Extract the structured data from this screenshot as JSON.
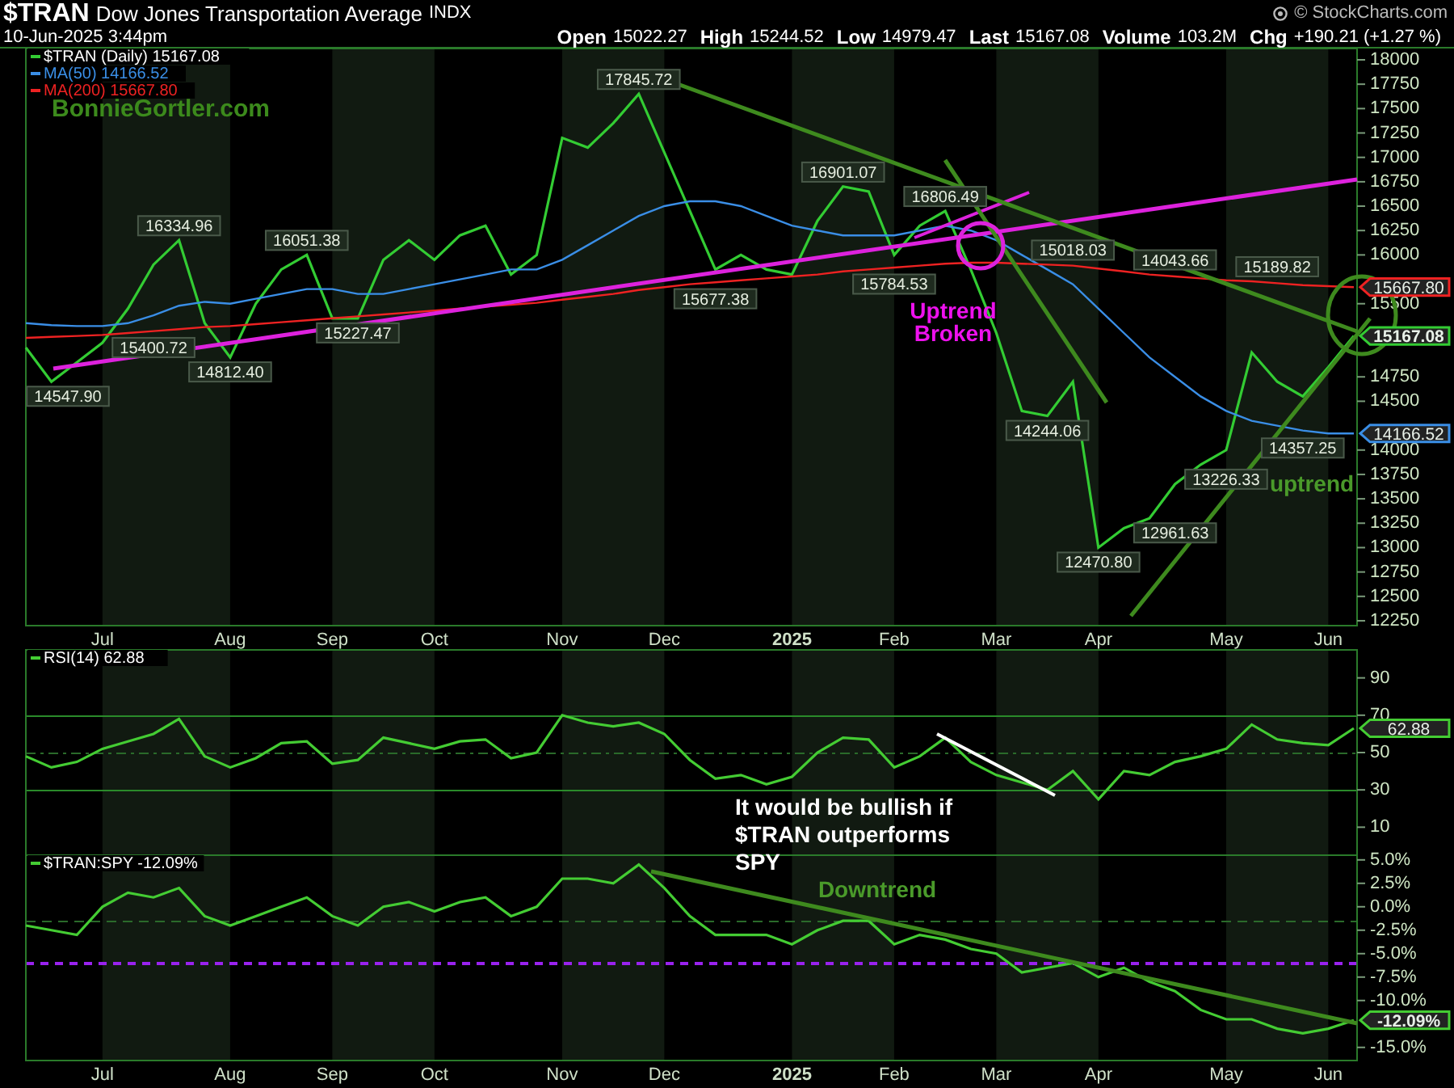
{
  "header": {
    "symbol": "$TRAN",
    "name": "Dow Jones Transportation Average",
    "exchange": "INDX",
    "credit": "© StockCharts.com",
    "date": "10-Jun-2025 3:44pm",
    "quote": [
      {
        "label": "Open",
        "value": "15022.27"
      },
      {
        "label": "High",
        "value": "15244.52"
      },
      {
        "label": "Low",
        "value": "14979.47"
      },
      {
        "label": "Last",
        "value": "15167.08"
      },
      {
        "label": "Volume",
        "value": "103.2M"
      },
      {
        "label": "Chg",
        "value": "+190.21 (+1.27 %)"
      }
    ]
  },
  "price_panel": {
    "site_text": "BonnieGortler.com",
    "price_labels": [
      {
        "kind": "low",
        "text": "14547.90"
      },
      {
        "kind": "low",
        "text": "15400.72"
      },
      {
        "kind": "low",
        "text": "14812.40"
      },
      {
        "kind": "high",
        "text": "16334.96"
      },
      {
        "kind": "high",
        "text": "16051.38"
      },
      {
        "kind": "low",
        "text": "15227.47"
      },
      {
        "kind": "high",
        "text": "17845.72"
      },
      {
        "kind": "low",
        "text": "15677.38"
      },
      {
        "kind": "high",
        "text": "16901.07"
      },
      {
        "kind": "low",
        "text": "15784.53"
      },
      {
        "kind": "high",
        "text": "16806.49"
      },
      {
        "kind": "high",
        "text": "15018.03"
      },
      {
        "kind": "low",
        "text": "14244.06"
      },
      {
        "kind": "low",
        "text": "12470.80"
      },
      {
        "kind": "low",
        "text": "12961.63"
      },
      {
        "kind": "low",
        "text": "13226.33"
      },
      {
        "kind": "high",
        "text": "14043.66"
      },
      {
        "kind": "high",
        "text": "15189.82"
      },
      {
        "kind": "low",
        "text": "14357.25"
      }
    ],
    "notes": [
      {
        "lines": [
          "Uptrend",
          "Broken"
        ]
      },
      {
        "lines": [
          "uptrend"
        ]
      }
    ],
    "value_tags": [
      "15667.80",
      "15167.08",
      "14166.52"
    ],
    "chart_data": {
      "type": "line",
      "ylim": [
        12200,
        18116
      ],
      "categories": [
        null,
        null,
        null,
        "Jul",
        null,
        null,
        null,
        null,
        "Aug",
        null,
        null,
        null,
        "Sep",
        null,
        null,
        null,
        "Oct",
        null,
        null,
        null,
        null,
        "Nov",
        null,
        null,
        null,
        "Dec",
        null,
        null,
        null,
        null,
        "2025",
        null,
        null,
        null,
        "Feb",
        null,
        null,
        null,
        "Mar",
        null,
        null,
        null,
        "Apr",
        null,
        null,
        null,
        null,
        "May",
        null,
        null,
        null,
        "Jun",
        null
      ],
      "series": [
        {
          "name": "$TRAN (Daily) 15167.08",
          "color": "#33cc33",
          "values": [
            15050,
            14700,
            14900,
            15100,
            15450,
            15900,
            16150,
            15300,
            14950,
            15500,
            15850,
            16000,
            15350,
            15350,
            15950,
            16150,
            15950,
            16200,
            16300,
            15800,
            16000,
            17200,
            17100,
            17350,
            17650,
            17050,
            16450,
            15850,
            16000,
            15850,
            15800,
            16350,
            16700,
            16650,
            16000,
            16300,
            16450,
            15850,
            15200,
            14400,
            14350,
            14700,
            13000,
            13200,
            13300,
            13650,
            13850,
            14000,
            15000,
            14700,
            14550,
            14850,
            15170
          ]
        },
        {
          "name": "MA(50) 14166.52",
          "color": "#3a8ee6",
          "values": [
            15300,
            15280,
            15270,
            15270,
            15300,
            15380,
            15480,
            15520,
            15500,
            15550,
            15600,
            15650,
            15650,
            15600,
            15600,
            15650,
            15700,
            15750,
            15800,
            15850,
            15850,
            15950,
            16100,
            16250,
            16400,
            16500,
            16550,
            16550,
            16500,
            16400,
            16300,
            16250,
            16200,
            16200,
            16200,
            16250,
            16300,
            16250,
            16150,
            16000,
            15850,
            15700,
            15450,
            15200,
            14950,
            14750,
            14550,
            14400,
            14300,
            14250,
            14200,
            14170,
            14170
          ]
        },
        {
          "name": "MA(200) 15667.80",
          "color": "#ee2222",
          "values": [
            15150,
            15160,
            15170,
            15180,
            15200,
            15220,
            15240,
            15260,
            15270,
            15290,
            15310,
            15330,
            15350,
            15370,
            15390,
            15410,
            15430,
            15450,
            15470,
            15490,
            15510,
            15540,
            15570,
            15600,
            15640,
            15670,
            15700,
            15720,
            15740,
            15760,
            15780,
            15800,
            15830,
            15850,
            15870,
            15890,
            15910,
            15920,
            15920,
            15910,
            15900,
            15890,
            15860,
            15830,
            15800,
            15780,
            15760,
            15740,
            15730,
            15710,
            15690,
            15680,
            15670
          ]
        }
      ],
      "yticks": [
        12250,
        12500,
        12750,
        13000,
        13250,
        13500,
        13750,
        14000,
        14500,
        14750,
        15500,
        16000,
        16250,
        16500,
        16750,
        17000,
        17250,
        17500,
        17750,
        18000
      ]
    }
  },
  "rsi_panel": {
    "notes": [
      {
        "lines": [
          "It would be bullish if",
          "$TRAN outperforms",
          "SPY"
        ]
      }
    ],
    "value_tags": [
      "62.88"
    ],
    "chart_data": {
      "type": "line",
      "ylim": [
        -5,
        105
      ],
      "yticks": [
        10,
        30,
        50,
        70,
        90
      ],
      "series": [
        {
          "name": "RSI(14) 62.88",
          "color": "#44cc33",
          "values": [
            48,
            42,
            45,
            52,
            56,
            60,
            68,
            48,
            42,
            47,
            55,
            56,
            44,
            46,
            58,
            55,
            52,
            56,
            57,
            47,
            50,
            70,
            66,
            64,
            66,
            60,
            46,
            36,
            38,
            33,
            37,
            50,
            58,
            57,
            42,
            48,
            58,
            45,
            38,
            34,
            30,
            40,
            25,
            40,
            38,
            45,
            48,
            52,
            65,
            57,
            55,
            54,
            63
          ]
        }
      ]
    }
  },
  "ratio_panel": {
    "notes": [
      {
        "lines": [
          "Downtrend"
        ]
      }
    ],
    "value_tags": [
      "-12.09%"
    ],
    "chart_data": {
      "type": "line",
      "ylim": [
        -16.4,
        5.5
      ],
      "categories": [
        null,
        null,
        null,
        "Jul",
        null,
        null,
        null,
        null,
        "Aug",
        null,
        null,
        null,
        "Sep",
        null,
        null,
        null,
        "Oct",
        null,
        null,
        null,
        null,
        "Nov",
        null,
        null,
        null,
        "Dec",
        null,
        null,
        null,
        null,
        "2025",
        null,
        null,
        null,
        "Feb",
        null,
        null,
        null,
        "Mar",
        null,
        null,
        null,
        "Apr",
        null,
        null,
        null,
        null,
        "May",
        null,
        null,
        null,
        "Jun",
        null
      ],
      "yticks": [
        {
          "value": 5,
          "label": "5.0%"
        },
        {
          "value": 2.5,
          "label": "2.5%"
        },
        {
          "value": 0,
          "label": "0.0%"
        },
        {
          "value": -2.5,
          "label": "-2.5%"
        },
        {
          "value": -5,
          "label": "-5.0%"
        },
        {
          "value": -7.5,
          "label": "-7.5%"
        },
        {
          "value": -10,
          "label": "-10.0%"
        },
        {
          "value": -15,
          "label": "-15.0%"
        }
      ],
      "series": [
        {
          "name": "$TRAN:SPY -12.09%",
          "color": "#44cc33",
          "values": [
            -2,
            -2.5,
            -3,
            0,
            1.5,
            1,
            2,
            -1,
            -2,
            -1,
            0,
            1,
            -1,
            -2,
            0,
            0.5,
            -0.5,
            0.5,
            1,
            -1,
            0,
            3,
            3,
            2.5,
            4.5,
            2,
            -1,
            -3,
            -3,
            -3,
            -4,
            -2.5,
            -1.5,
            -1.5,
            -4,
            -3,
            -3.5,
            -4.5,
            -5,
            -7,
            -6.5,
            -6,
            -7.5,
            -6.5,
            -8,
            -9,
            -11,
            -12,
            -12,
            -13,
            -13.5,
            -13,
            -12.1
          ]
        }
      ]
    }
  }
}
